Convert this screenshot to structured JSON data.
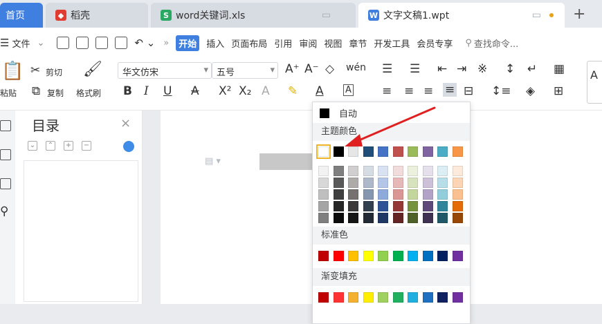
{
  "tabs": {
    "home": "首页",
    "daoke": "稻壳",
    "xls": "word关键词.xls",
    "wpt": "文字文稿1.wpt",
    "add": "+"
  },
  "menu": {
    "file": "文件",
    "more": "»",
    "start": "开始",
    "insert": "插入",
    "layout": "页面布局",
    "reference": "引用",
    "review": "审阅",
    "view": "视图",
    "chapter": "章节",
    "dev": "开发工具",
    "member": "会员专享",
    "search": "查找命令..."
  },
  "ribbon": {
    "cut": "剪切",
    "paste": "粘贴",
    "copy": "复制",
    "format_painter": "格式刷",
    "font_name": "华文仿宋",
    "font_size": "五号",
    "bold": "B",
    "italic": "I",
    "underline": "U",
    "strike": "A",
    "superscript": "X²",
    "subscript": "X₂",
    "font_color": "A",
    "char_border": "A",
    "grow": "A⁺",
    "shrink": "A⁻",
    "pinyin": "wén",
    "style_preview": "A"
  },
  "nav_pane": {
    "title": "目录",
    "close": "×"
  },
  "color_menu": {
    "auto_label": "自动",
    "theme_label": "主题颜色",
    "standard_label": "标准色",
    "gradient_label": "渐变填充",
    "theme_top": [
      "#ffffff",
      "#000000",
      "#e7e6e6",
      "#1f4e79",
      "#4472c4",
      "#c0504d",
      "#9bbb59",
      "#8064a2",
      "#4bacc6",
      "#f79646"
    ],
    "theme_shades": [
      [
        "#f2f2f2",
        "#7f7f7f",
        "#d0cece",
        "#d6dce4",
        "#d9e2f3",
        "#f2dcdb",
        "#ebf1dd",
        "#e5e0ec",
        "#dbeef3",
        "#fdeada"
      ],
      [
        "#d8d8d8",
        "#595959",
        "#aeaaaa",
        "#adb9ca",
        "#b4c6e7",
        "#e6b8b7",
        "#d7e3bc",
        "#ccc1d9",
        "#b7dde8",
        "#fbd5b5"
      ],
      [
        "#bfbfbf",
        "#3f3f3f",
        "#757171",
        "#8496b0",
        "#8eaadb",
        "#d99694",
        "#c3d69b",
        "#b2a2c7",
        "#92cddc",
        "#fac08f"
      ],
      [
        "#a5a5a5",
        "#262626",
        "#3a3838",
        "#323f4f",
        "#2f5496",
        "#953734",
        "#76923c",
        "#5f497a",
        "#31859b",
        "#e36c09"
      ],
      [
        "#7f7f7f",
        "#0c0c0c",
        "#171616",
        "#222a35",
        "#1f3864",
        "#632423",
        "#4f6128",
        "#3f3151",
        "#205867",
        "#974806"
      ]
    ],
    "standard": [
      "#c00000",
      "#ff0000",
      "#ffc000",
      "#ffff00",
      "#92d050",
      "#00b050",
      "#00b0f0",
      "#0070c0",
      "#002060",
      "#7030a0"
    ],
    "gradient": [
      "#c00000",
      "#ff3333",
      "#f4b130",
      "#ffee00",
      "#9fd060",
      "#20b060",
      "#20b0e0",
      "#1f70c0",
      "#102060",
      "#7030a0"
    ]
  },
  "accent_color": "#3f7fe0"
}
